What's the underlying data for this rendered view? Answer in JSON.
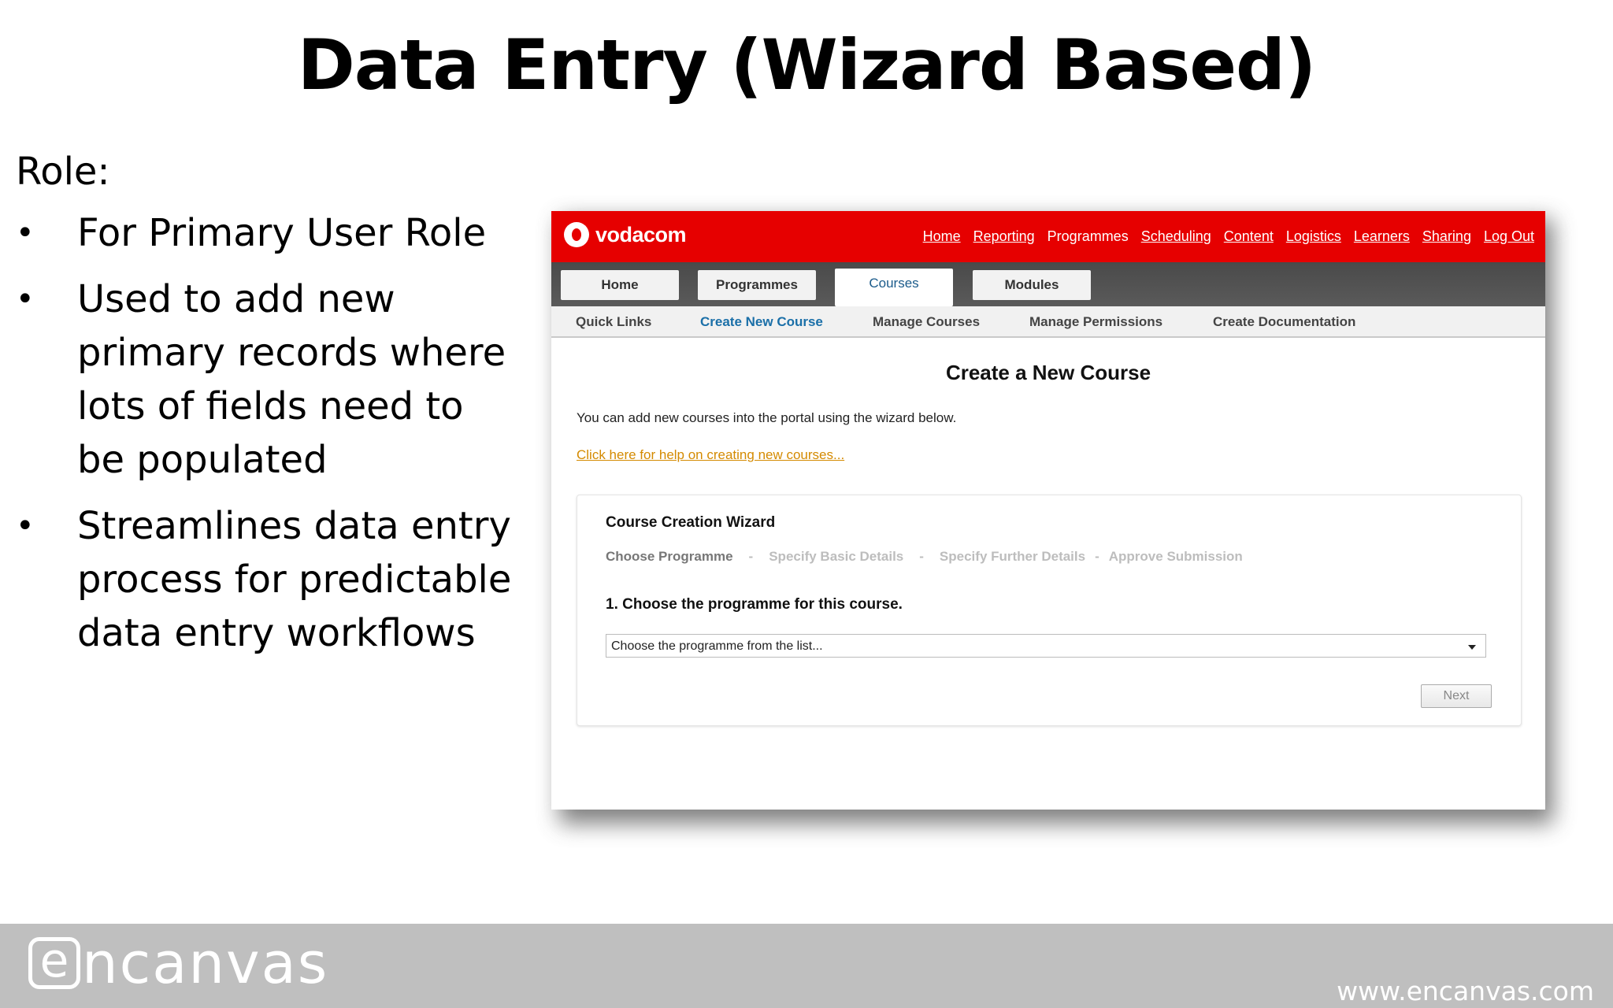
{
  "slide": {
    "title": "Data Entry (Wizard Based)",
    "role_heading": "Role:",
    "bullet_symbol": "•",
    "bullets": [
      "For Primary User Role",
      "Used to add new primary records where lots of fields need to be populated",
      "Streamlines data entry process for predictable data entry workflows"
    ]
  },
  "app": {
    "logo_text": "vodacom",
    "top_nav": [
      "Home",
      "Reporting",
      "Programmes",
      "Scheduling",
      "Content",
      "Logistics",
      "Learners",
      "Sharing",
      "Log Out"
    ],
    "tabs": [
      "Home",
      "Programmes",
      "Courses",
      "Modules"
    ],
    "active_tab": "Courses",
    "subnav": [
      "Quick Links",
      "Create New Course",
      "Manage Courses",
      "Manage Permissions",
      "Create Documentation"
    ],
    "active_subnav": "Create New Course",
    "page_title": "Create a New Course",
    "intro": "You can add new courses into the portal using the wizard below.",
    "help_link": "Click here for help on creating new courses...",
    "wizard": {
      "title": "Course Creation Wizard",
      "steps": [
        "Choose Programme",
        "Specify Basic Details",
        "Specify Further Details",
        "Approve Submission"
      ],
      "step_separator": "-",
      "current_step": "Choose Programme",
      "question": "1. Choose the programme for this course.",
      "select_value": "Choose the programme from the list...",
      "next_label": "Next"
    },
    "colors": {
      "brand_red": "#e60000",
      "link_orange": "#d48a00",
      "active_blue": "#1a6fa8"
    }
  },
  "footer": {
    "brand_e": "e",
    "brand_rest": "ncanvas",
    "url": "www.encanvas.com"
  }
}
